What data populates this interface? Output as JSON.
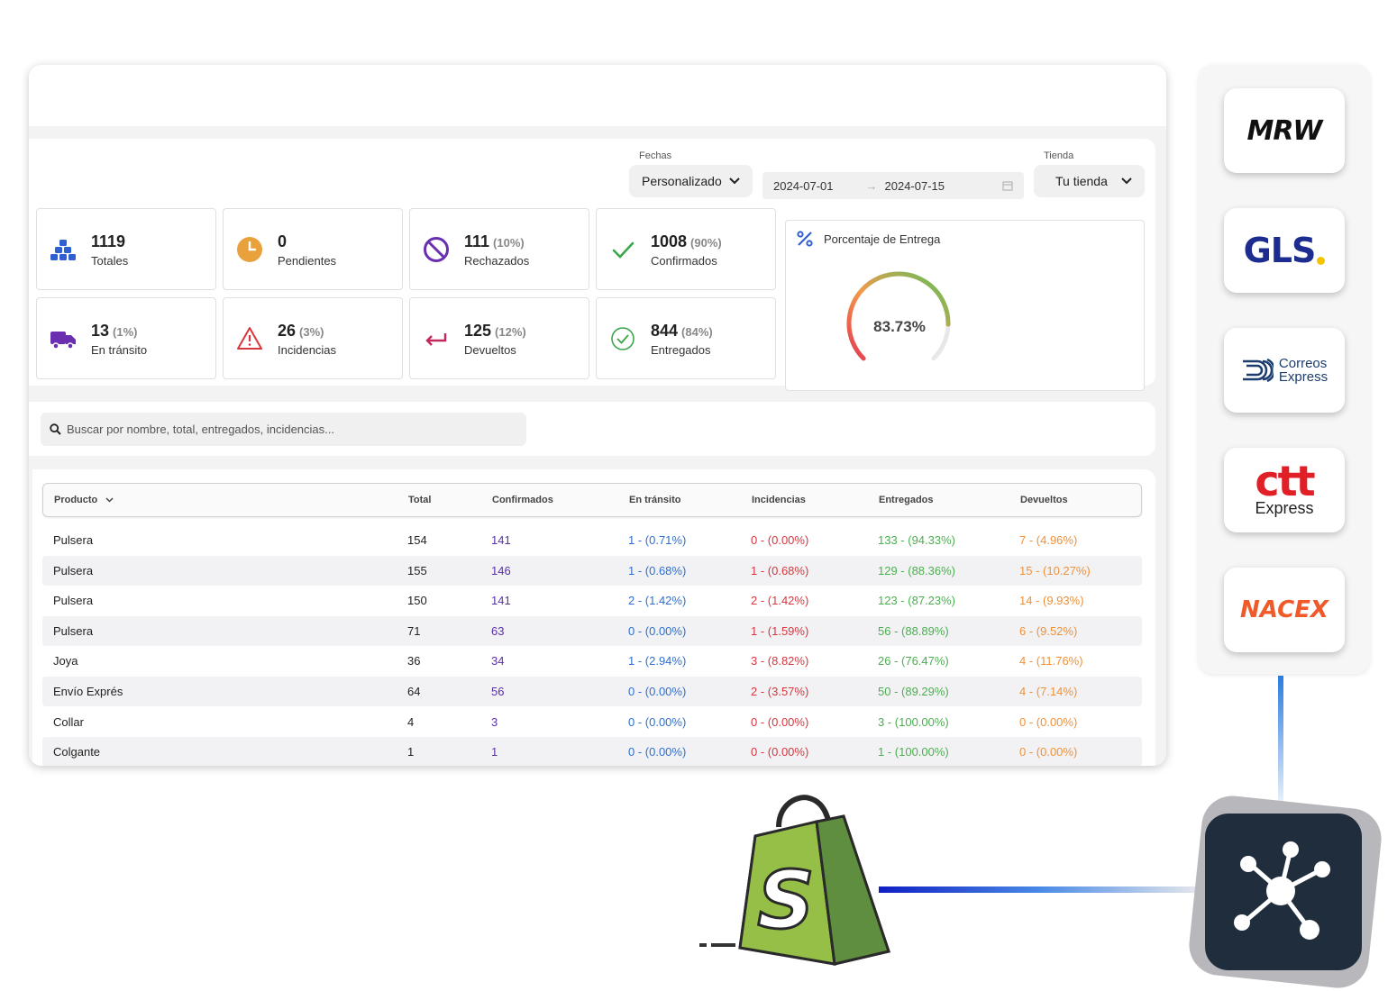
{
  "filters": {
    "dates_label": "Fechas",
    "dates_value": "Personalizado",
    "date_from": "2024-07-01",
    "date_to": "2024-07-15",
    "store_label": "Tienda",
    "store_value": "Tu tienda"
  },
  "stats": {
    "totales": {
      "value": "1119",
      "pct": "",
      "label": "Totales"
    },
    "pendientes": {
      "value": "0",
      "pct": "",
      "label": "Pendientes"
    },
    "rechazados": {
      "value": "111",
      "pct": "(10%)",
      "label": "Rechazados"
    },
    "confirmados": {
      "value": "1008",
      "pct": "(90%)",
      "label": "Confirmados"
    },
    "en_transito": {
      "value": "13",
      "pct": "(1%)",
      "label": "En tránsito"
    },
    "incidencias": {
      "value": "26",
      "pct": "(3%)",
      "label": "Incidencias"
    },
    "devueltos": {
      "value": "125",
      "pct": "(12%)",
      "label": "Devueltos"
    },
    "entregados": {
      "value": "844",
      "pct": "(84%)",
      "label": "Entregados"
    }
  },
  "gauge": {
    "title": "Porcentaje de Entrega",
    "value_text": "83.73%",
    "fraction": 0.8373
  },
  "search": {
    "placeholder": "Buscar por nombre, total, entregados, incidencias..."
  },
  "table": {
    "headers": {
      "producto": "Producto",
      "total": "Total",
      "confirmados": "Confirmados",
      "en_transito": "En tránsito",
      "incidencias": "Incidencias",
      "entregados": "Entregados",
      "devueltos": "Devueltos"
    },
    "rows": [
      {
        "producto": "Pulsera",
        "total": "154",
        "confirmados": "141",
        "en_transito": "1 - (0.71%)",
        "incidencias": "0 - (0.00%)",
        "entregados": "133 - (94.33%)",
        "devueltos": "7 - (4.96%)"
      },
      {
        "producto": "Pulsera",
        "total": "155",
        "confirmados": "146",
        "en_transito": "1 - (0.68%)",
        "incidencias": "1 - (0.68%)",
        "entregados": "129 - (88.36%)",
        "devueltos": "15 - (10.27%)"
      },
      {
        "producto": "Pulsera",
        "total": "150",
        "confirmados": "141",
        "en_transito": "2 - (1.42%)",
        "incidencias": "2 - (1.42%)",
        "entregados": "123 - (87.23%)",
        "devueltos": "14 - (9.93%)"
      },
      {
        "producto": "Pulsera",
        "total": "71",
        "confirmados": "63",
        "en_transito": "0 - (0.00%)",
        "incidencias": "1 - (1.59%)",
        "entregados": "56 - (88.89%)",
        "devueltos": "6 - (9.52%)"
      },
      {
        "producto": "Joya",
        "total": "36",
        "confirmados": "34",
        "en_transito": "1 - (2.94%)",
        "incidencias": "3 - (8.82%)",
        "entregados": "26 - (76.47%)",
        "devueltos": "4 - (11.76%)"
      },
      {
        "producto": "Envío Exprés",
        "total": "64",
        "confirmados": "56",
        "en_transito": "0 - (0.00%)",
        "incidencias": "2 - (3.57%)",
        "entregados": "50 - (89.29%)",
        "devueltos": "4 - (7.14%)"
      },
      {
        "producto": "Collar",
        "total": "4",
        "confirmados": "3",
        "en_transito": "0 - (0.00%)",
        "incidencias": "0 - (0.00%)",
        "entregados": "3 - (100.00%)",
        "devueltos": "0 - (0.00%)"
      },
      {
        "producto": "Colgante",
        "total": "1",
        "confirmados": "1",
        "en_transito": "0 - (0.00%)",
        "incidencias": "0 - (0.00%)",
        "entregados": "1 - (100.00%)",
        "devueltos": "0 - (0.00%)"
      }
    ]
  },
  "colors": {
    "confirmados": "#5b2fa8",
    "en_transito": "#2f6fd1",
    "incidencias": "#d9363e",
    "entregados": "#4caf50",
    "devueltos": "#f0913a"
  },
  "carriers": {
    "mrw": "MRW",
    "gls": "GLS",
    "correos_line1": "Correos",
    "correos_line2": "Express",
    "ctt_line1": "ctt",
    "ctt_line2": "Express",
    "nacex": "NACEX"
  },
  "icons": [
    "boxes-icon",
    "clock-icon",
    "ban-icon",
    "check-icon",
    "truck-icon",
    "warning-icon",
    "return-arrow-icon",
    "check-circle-icon",
    "percent-icon",
    "search-icon",
    "chevron-down-icon",
    "calendar-icon",
    "shopify-bag-icon",
    "network-hub-icon"
  ]
}
